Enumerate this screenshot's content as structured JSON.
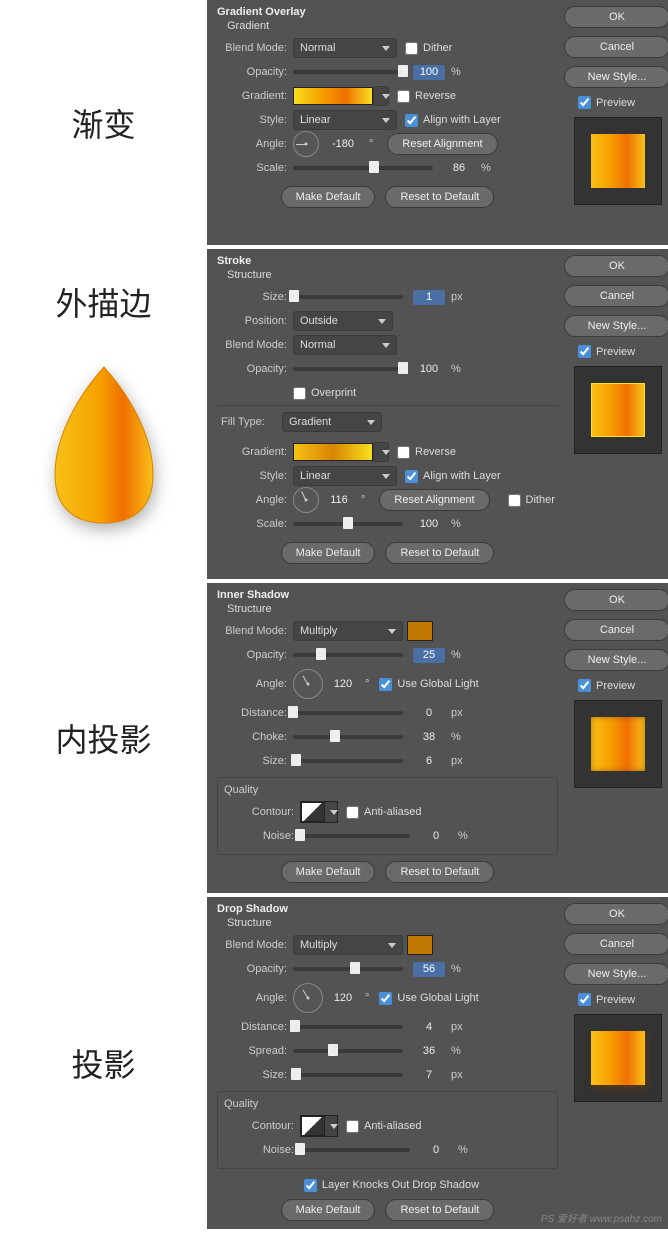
{
  "buttons": {
    "ok": "OK",
    "cancel": "Cancel",
    "newstyle": "New Style...",
    "preview": "Preview",
    "makedefault": "Make Default",
    "reset": "Reset to Default",
    "resetalign": "Reset Alignment"
  },
  "labels": {
    "blendmode": "Blend Mode:",
    "opacity": "Opacity:",
    "gradient": "Gradient:",
    "style": "Style:",
    "angle": "Angle:",
    "scale": "Scale:",
    "size": "Size:",
    "position": "Position:",
    "filltype": "Fill Type:",
    "distance": "Distance:",
    "choke": "Choke:",
    "spread": "Spread:",
    "contour": "Contour:",
    "noise": "Noise:"
  },
  "checks": {
    "dither": "Dither",
    "reverse": "Reverse",
    "align": "Align with Layer",
    "overprint": "Overprint",
    "globallight": "Use Global Light",
    "antialiased": "Anti-aliased",
    "knockout": "Layer Knocks Out Drop Shadow"
  },
  "units": {
    "percent": "%",
    "px": "px",
    "deg": "°"
  },
  "p1": {
    "chinese": "渐变",
    "title": "Gradient Overlay",
    "sub": "Gradient",
    "blend": "Normal",
    "opacity": "100",
    "style": "Linear",
    "angle": "-180",
    "scale": "86"
  },
  "p2": {
    "chinese": "外描边",
    "title": "Stroke",
    "sub": "Structure",
    "size": "1",
    "position": "Outside",
    "blend": "Normal",
    "opacity": "100",
    "filltype": "Gradient",
    "style": "Linear",
    "angle": "116",
    "scale": "100"
  },
  "p3": {
    "chinese": "内投影",
    "title": "Inner Shadow",
    "sub": "Structure",
    "blend": "Multiply",
    "opacity": "25",
    "angle": "120",
    "distance": "0",
    "choke": "38",
    "size": "6",
    "quality": "Quality",
    "noise": "0",
    "color": "#c07800"
  },
  "p4": {
    "chinese": "投影",
    "title": "Drop Shadow",
    "sub": "Structure",
    "blend": "Multiply",
    "opacity": "56",
    "angle": "120",
    "distance": "4",
    "spread": "36",
    "size": "7",
    "quality": "Quality",
    "noise": "0",
    "color": "#c07800"
  },
  "watermark": "PS 爱好者 www.psahz.com",
  "colors": {
    "g1": "#f8e020",
    "g2": "#f6a200",
    "g3": "#f07000"
  }
}
